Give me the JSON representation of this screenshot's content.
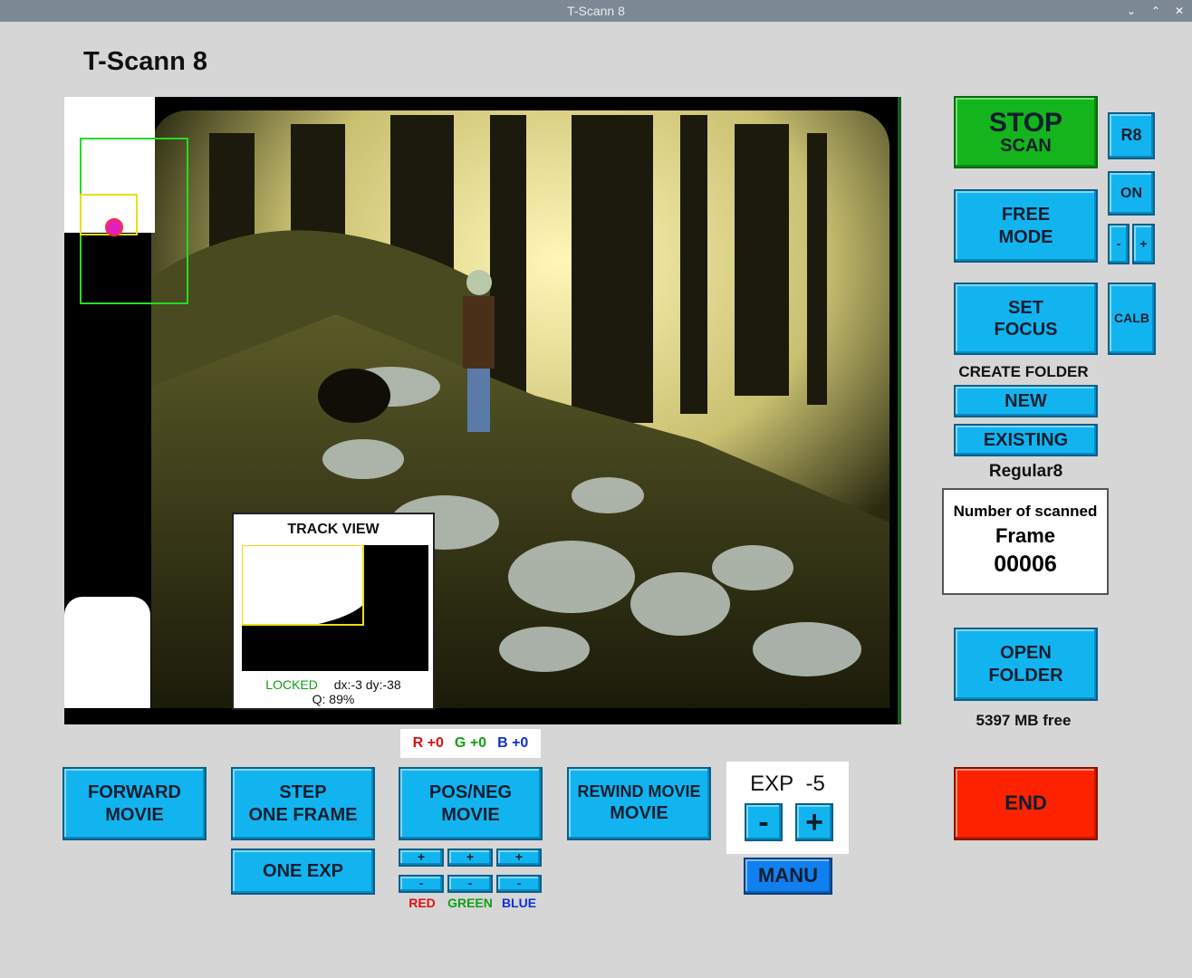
{
  "window": {
    "title": "T-Scann 8"
  },
  "app": {
    "title": "T-Scann 8"
  },
  "buttons": {
    "stop_scan_line1": "STOP",
    "stop_scan_line2": "SCAN",
    "r8": "R8",
    "on": "ON",
    "minus": "-",
    "plus": "+",
    "free_mode_line1": "FREE",
    "free_mode_line2": "MODE",
    "set_focus_line1": "SET",
    "set_focus_line2": "FOCUS",
    "calb": "CALB",
    "new": "NEW",
    "existing": "EXISTING",
    "open_folder_line1": "OPEN",
    "open_folder_line2": "FOLDER",
    "end": "END",
    "forward_line1": "FORWARD",
    "forward_line2": "MOVIE",
    "step_line1": "STEP",
    "step_line2": "ONE FRAME",
    "one_exp": "ONE EXP",
    "posneg_line1": "POS/NEG",
    "posneg_line2": "MOVIE",
    "rewind_line1": "REWIND MOVIE",
    "rewind_line2": "MOVIE",
    "exp_minus": "-",
    "exp_plus": "+",
    "manu": "MANU",
    "rgb_plus": "+",
    "rgb_minus": "-"
  },
  "labels": {
    "create_folder": "CREATE FOLDER",
    "film_type": "Regular8",
    "free_space": "5397 MB free",
    "red": "RED",
    "green": "GREEN",
    "blue": "BLUE"
  },
  "frame_counter": {
    "caption": "Number of scanned",
    "label": "Frame",
    "value": "00006"
  },
  "track_view": {
    "title": "TRACK VIEW",
    "status": "LOCKED",
    "dx": "dx:-3",
    "dy": "dy:-38",
    "quality": "Q: 89%"
  },
  "rgb": {
    "r": "R +0",
    "g": "G +0",
    "b": "B +0"
  },
  "exposure": {
    "label": "EXP",
    "value": "-5"
  },
  "colors": {
    "button_blue": "#12b4f0",
    "stop_green": "#14b41c",
    "end_red": "#ff2200",
    "manu_blue": "#1080f0",
    "red_text": "#e01010",
    "green_text": "#10a010",
    "blue_text": "#1030d0"
  }
}
